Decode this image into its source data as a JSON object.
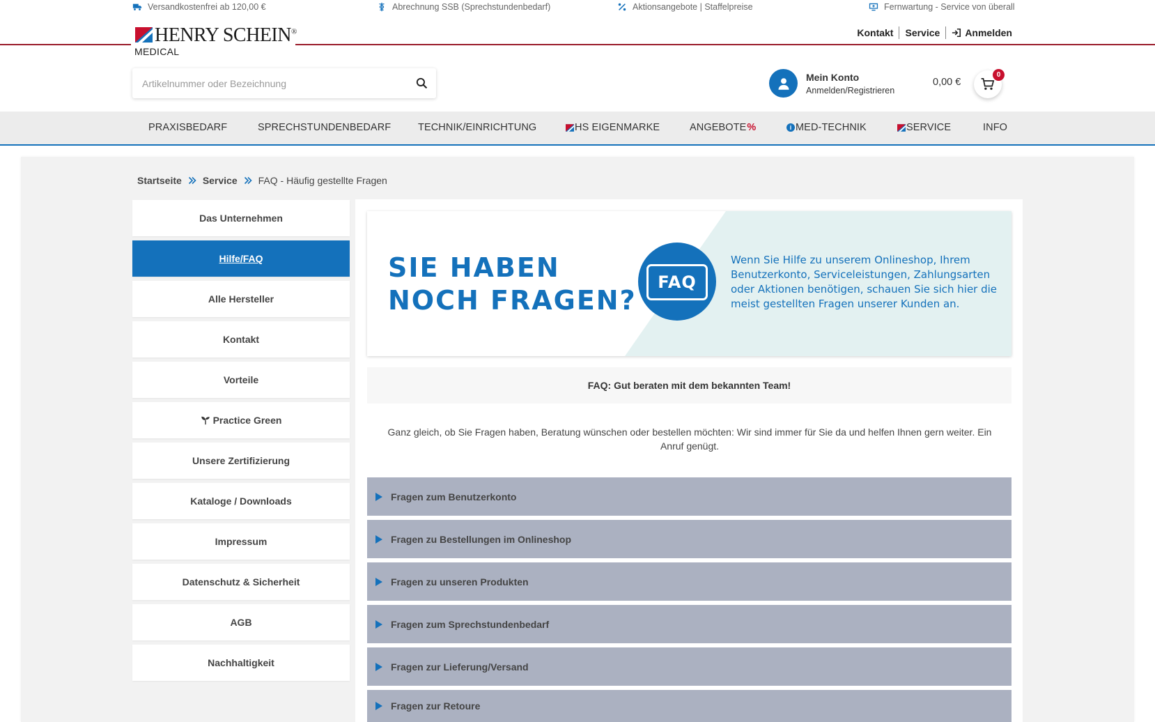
{
  "topbar": [
    {
      "icon": "truck-icon",
      "text": "Versandkostenfrei ab 120,00 €"
    },
    {
      "icon": "caduceus-icon",
      "text": "Abrechnung SSB (Sprechstundenbedarf)"
    },
    {
      "icon": "percent-icon",
      "text": "Aktionsangebote | Staffelpreise"
    },
    {
      "icon": "monitor-icon",
      "text": "Fernwartung - Service von überall"
    }
  ],
  "brand": {
    "name": "HENRY SCHEIN",
    "registered": "®",
    "sub": "MEDICAL"
  },
  "toplinks": {
    "kontakt": "Kontakt",
    "service": "Service",
    "login": "Anmelden"
  },
  "search": {
    "placeholder": "Artikelnummer oder Bezeichnung",
    "value": ""
  },
  "account": {
    "title": "Mein Konto",
    "subtitle": "Anmelden/Registrieren"
  },
  "cart": {
    "total": "0,00 €",
    "count": "0"
  },
  "nav": [
    {
      "label": "PRAXISBEDARF"
    },
    {
      "label": "SPRECHSTUNDENBEDARF"
    },
    {
      "label": "TECHNIK/EINRICHTUNG"
    },
    {
      "label": "HS EIGENMARKE"
    },
    {
      "label": "ANGEBOTE",
      "suffix": "%"
    },
    {
      "label": "MED-TECHNIK"
    },
    {
      "label": "SERVICE"
    },
    {
      "label": "INFO"
    }
  ],
  "breadcrumb": {
    "home": "Startseite",
    "section": "Service",
    "current": "FAQ - Häufig gestellte Fragen"
  },
  "sidebar": [
    {
      "label": "Das Unternehmen"
    },
    {
      "label": "Hilfe/FAQ"
    },
    {
      "label": "Alle Hersteller"
    },
    {
      "label": "Kontakt"
    },
    {
      "label": "Vorteile"
    },
    {
      "label": "Practice Green"
    },
    {
      "label": "Unsere Zertifizierung"
    },
    {
      "label": "Kataloge / Downloads"
    },
    {
      "label": "Impressum"
    },
    {
      "label": "Datenschutz & Sicherheit"
    },
    {
      "label": "AGB"
    },
    {
      "label": "Nachhaltigkeit"
    }
  ],
  "banner": {
    "headline_1": "SIE HABEN",
    "headline_2": "NOCH FRAGEN?",
    "badge": "FAQ",
    "text": "Wenn Sie Hilfe zu unserem Onlineshop, Ihrem Benutzerkonto, Serviceleistungen, Zahlungsarten oder Aktionen benötigen, schauen Sie sich hier die meist gestellten Fragen unserer Kunden an."
  },
  "team_heading": "FAQ: Gut beraten mit dem bekannten Team!",
  "intro": "Ganz gleich, ob Sie Fragen haben, Beratung wünschen oder bestellen möchten: Wir sind immer für Sie da und helfen Ihnen gern weiter. Ein Anruf genügt.",
  "faq_sections": [
    {
      "label": "Fragen zum Benutzerkonto"
    },
    {
      "label": "Fragen zu Bestellungen im Onlineshop"
    },
    {
      "label": "Fragen zu unseren Produkten"
    },
    {
      "label": "Fragen zum Sprechstundenbedarf"
    },
    {
      "label": "Fragen zur Lieferung/Versand"
    },
    {
      "label": "Fragen zur Retoure"
    }
  ],
  "colors": {
    "brand_blue": "#1471bb",
    "brand_red": "#c8102e",
    "accordion": "#abb1c1"
  }
}
